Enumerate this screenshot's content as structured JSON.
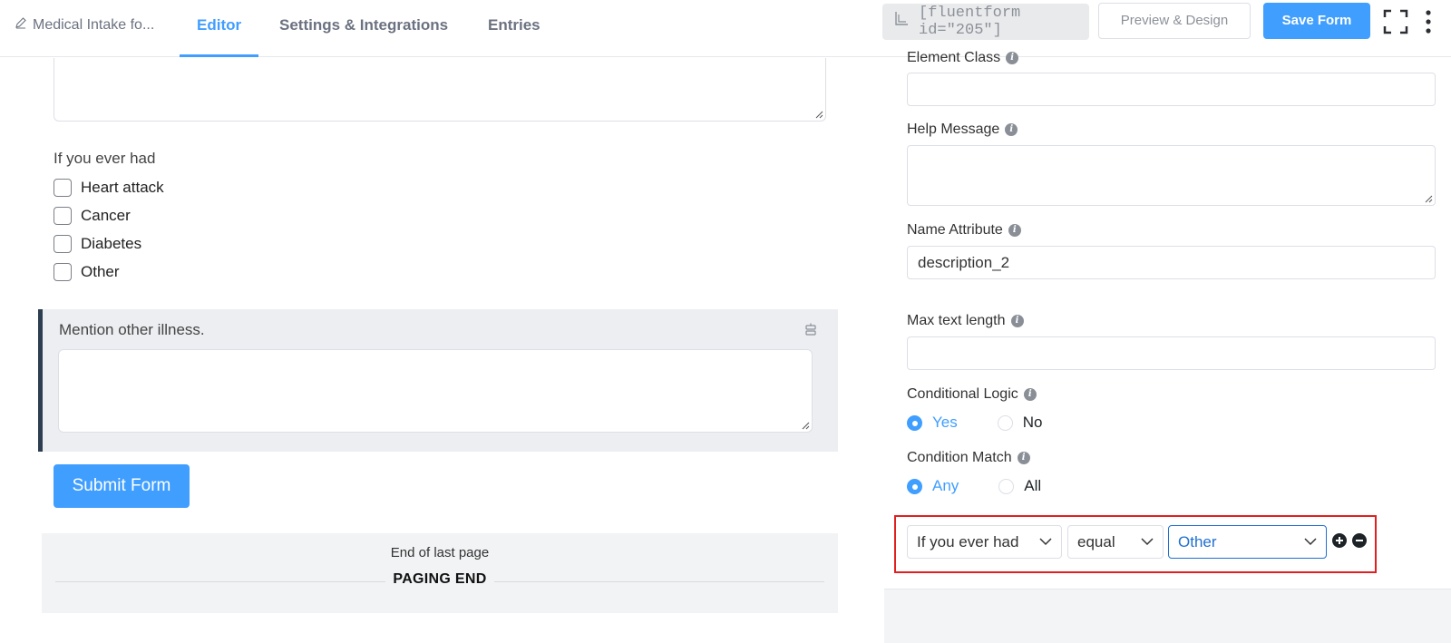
{
  "header": {
    "form_title": "Medical Intake fo...",
    "tabs": [
      {
        "label": "Editor",
        "active": true
      },
      {
        "label": "Settings & Integrations",
        "active": false
      },
      {
        "label": "Entries",
        "active": false
      }
    ],
    "shortcode": "[fluentform id=\"205\"]",
    "preview_label": "Preview & Design",
    "save_label": "Save Form"
  },
  "editor": {
    "question_label": "If you ever had",
    "options": [
      "Heart attack",
      "Cancer",
      "Diabetes",
      "Other"
    ],
    "selected_field_label": "Mention other illness.",
    "submit_label": "Submit Form",
    "paging_subtitle": "End of last page",
    "paging_title": "PAGING END"
  },
  "settings": {
    "element_class_label": "Element Class",
    "help_message_label": "Help Message",
    "name_attribute_label": "Name Attribute",
    "name_attribute_value": "description_2",
    "max_text_length_label": "Max text length",
    "conditional_logic_label": "Conditional Logic",
    "conditional_yes": "Yes",
    "conditional_no": "No",
    "condition_match_label": "Condition Match",
    "match_any": "Any",
    "match_all": "All",
    "rule": {
      "field": "If you ever had",
      "operator": "equal",
      "value": "Other"
    }
  },
  "colors": {
    "accent": "#409eff",
    "highlight_border": "#e02020"
  }
}
